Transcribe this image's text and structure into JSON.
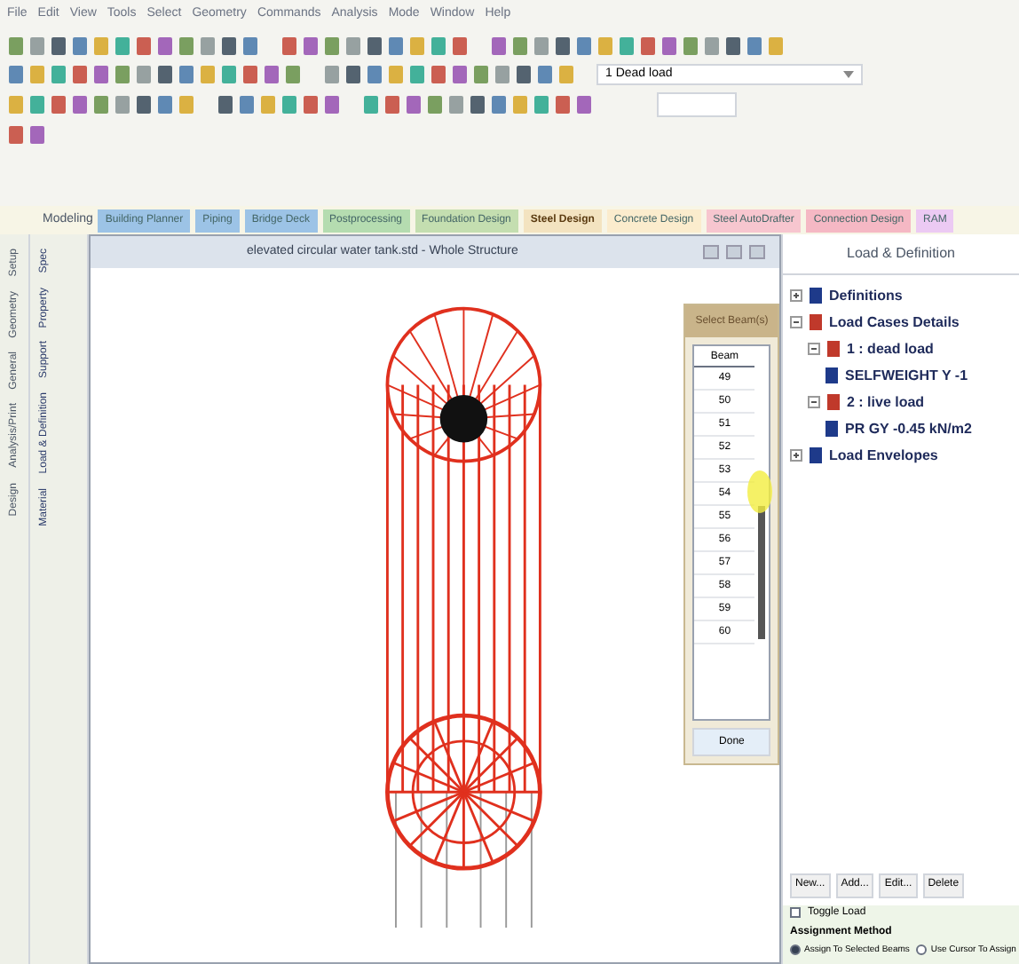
{
  "menu": [
    "File",
    "Edit",
    "View",
    "Tools",
    "Select",
    "Geometry",
    "Commands",
    "Analysis",
    "Mode",
    "Window",
    "Help"
  ],
  "toolbars": {
    "load_combo": "1 Dead load"
  },
  "page_label": "Modeling",
  "ribbon_tabs": [
    {
      "label": "Building Planner",
      "color": "#9cc3e6",
      "selected": false
    },
    {
      "label": "Piping",
      "color": "#9cc3e6",
      "selected": false
    },
    {
      "label": "Bridge Deck",
      "color": "#9cc3e6",
      "selected": false
    },
    {
      "label": "Postprocessing",
      "color": "#b5dcb0",
      "selected": false
    },
    {
      "label": "Foundation Design",
      "color": "#c4deb0",
      "selected": false
    },
    {
      "label": "Steel Design",
      "color": "#f3e3c0",
      "selected": true
    },
    {
      "label": "Concrete Design",
      "color": "#fbeccd",
      "selected": false
    },
    {
      "label": "Steel AutoDrafter",
      "color": "#f7c6cf",
      "selected": false
    },
    {
      "label": "Connection Design",
      "color": "#f5b8c4",
      "selected": false
    },
    {
      "label": "RAM",
      "color": "#eccaf3",
      "selected": false
    }
  ],
  "side_tabs": [
    "Setup",
    "Geometry",
    "General",
    "Analysis/Print",
    "Design"
  ],
  "side_tabs_2": [
    "Spec",
    "Property",
    "Support",
    "Load & Definition",
    "Material"
  ],
  "viewport": {
    "title": "elevated circular water tank.std - Whole Structure"
  },
  "beam_dialog": {
    "title": "Select Beam(s)",
    "column": "Beam",
    "rows": [
      "49",
      "50",
      "51",
      "52",
      "53",
      "54",
      "55",
      "56",
      "57",
      "58",
      "59",
      "60"
    ],
    "button": "Done"
  },
  "load_panel": {
    "title": "Load & Definition",
    "tree": [
      {
        "label": "Definitions",
        "expanded": false
      },
      {
        "label": "Load Cases Details",
        "expanded": true,
        "children": [
          {
            "label": "1 : dead load",
            "expanded": true,
            "children": [
              {
                "label": "SELFWEIGHT Y -1"
              }
            ]
          },
          {
            "label": "2 : live load",
            "expanded": true,
            "children": [
              {
                "label": "PR GY -0.45 kN/m2"
              }
            ]
          }
        ]
      },
      {
        "label": "Load Envelopes",
        "expanded": false
      }
    ],
    "buttons": [
      "New...",
      "Add...",
      "Edit...",
      "Delete"
    ],
    "toggle": {
      "label": "Toggle Load",
      "checked": false
    },
    "method_label": "Assignment Method",
    "methods": [
      {
        "label": "Assign To Selected Beams",
        "selected": true
      },
      {
        "label": "Use Cursor To Assign",
        "selected": false
      }
    ]
  }
}
